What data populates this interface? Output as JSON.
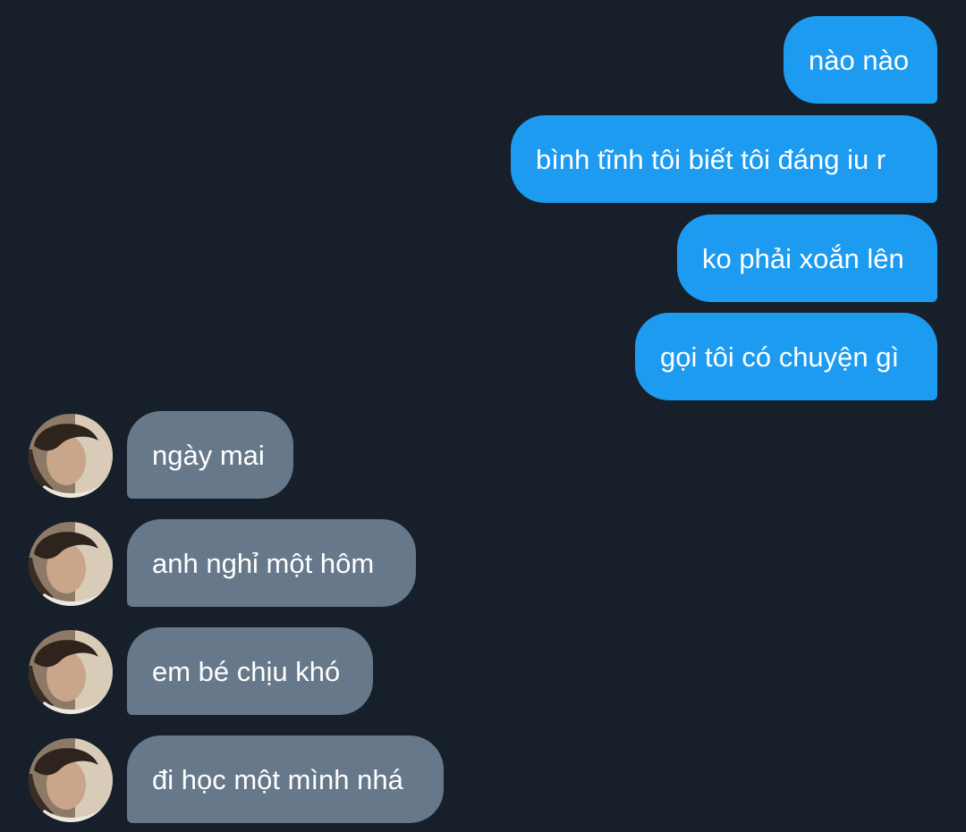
{
  "conversation": {
    "sent": [
      {
        "text": "nào nào"
      },
      {
        "text": "bình tĩnh tôi biết tôi đáng iu r"
      },
      {
        "text": "ko phải xoắn lên"
      },
      {
        "text": "gọi tôi có chuyện gì"
      }
    ],
    "received": [
      {
        "text": "ngày mai"
      },
      {
        "text": "anh nghỉ một hôm"
      },
      {
        "text": "em bé chịu khó"
      },
      {
        "text": "đi học một mình nhá"
      }
    ]
  },
  "colors": {
    "background": "#17202a",
    "sent_bubble": "#1d9bf0",
    "received_bubble": "#66788a",
    "text": "#ffffff"
  },
  "icons": {
    "avatar": "contact-avatar-photo"
  }
}
